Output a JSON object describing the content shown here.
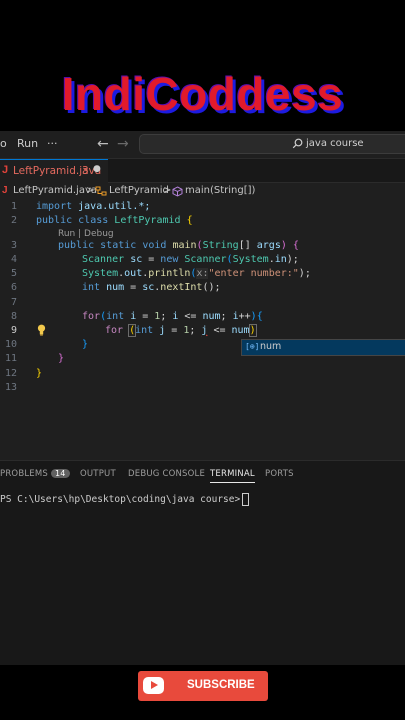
{
  "banner": {
    "text": "IndiCoddess"
  },
  "titlebar": {
    "menu_truncated": "o",
    "run_label": "Run",
    "more_label": "···",
    "back_glyph": "←",
    "forward_glyph": "→",
    "search_text": "java course",
    "search_icon": "search-icon"
  },
  "tab": {
    "icon_letter": "J",
    "filename": "LeftPyramid.java",
    "problems_count": "3",
    "modified_dot": "●"
  },
  "breadcrumbs": {
    "file_icon": "J",
    "file": "LeftPyramid.java",
    "sep1": ">",
    "class_icon": "class-icon",
    "class_name": "LeftPyramid",
    "sep2": ">",
    "method_icon": "method-icon",
    "method": "main(String[])"
  },
  "editor": {
    "line_numbers": [
      "1",
      "2",
      "3",
      "4",
      "5",
      "6",
      "7",
      "8",
      "9",
      "10",
      "11",
      "12",
      "13"
    ],
    "active_line": "9",
    "codelens": "Run | Debug",
    "lines": {
      "l1": {
        "kw": "import",
        "rest": " java.util.*;"
      },
      "l2": {
        "kw1": "public",
        "kw2": "class",
        "name": "LeftPyramid",
        "brace": "{"
      },
      "l3": {
        "kw1": "public",
        "kw2": "static",
        "kw3": "void",
        "fn": "main",
        "p1": "(",
        "type": "String",
        "arr": "[]",
        "arg": "args",
        "p2": ")",
        "brace": "{"
      },
      "l4": {
        "type": "Scanner",
        "var": "sc",
        "eq": " = ",
        "kw": "new",
        "type2": "Scanner",
        "p1": "(",
        "cls": "System",
        "dot": ".",
        "fld": "in",
        "p2": ");"
      },
      "l5": {
        "cls": "System",
        "dot1": ".",
        "fld": "out",
        "dot2": ".",
        "fn": "println",
        "p1": "(",
        "hint": "x:",
        "str": "\"enter number:\"",
        "p2": ");"
      },
      "l6": {
        "kw": "int",
        "var": "num",
        "eq": " = ",
        "obj": "sc",
        "dot": ".",
        "fn": "nextInt",
        "p": "();"
      },
      "l8": {
        "kw": "for",
        "p1": "(",
        "kw2": "int",
        "i": "i",
        "eq": " = ",
        "one": "1",
        "semi1": "; ",
        "i2": "i",
        "le": " <= ",
        "num": "num",
        "semi2": "; ",
        "i3": "i",
        "inc": "++",
        "p2": ")",
        "brace": "{"
      },
      "l9": {
        "kw": "for",
        "p1": "(",
        "kw2": "int",
        "j": "j",
        "eq": " = ",
        "one": "1",
        "semi1": "; ",
        "j2": "j",
        "le": " <= ",
        "num": "num",
        "p2": ")"
      },
      "l10": {
        "brace": "}"
      },
      "l11": {
        "brace": "}"
      },
      "l12": {
        "brace": "}"
      }
    },
    "suggestion": {
      "icon": "[⊕]",
      "label": "num"
    }
  },
  "panel": {
    "tabs": [
      "PROBLEMS",
      "OUTPUT",
      "DEBUG CONSOLE",
      "TERMINAL",
      "PORTS"
    ],
    "problems_badge": "14",
    "active_tab": "TERMINAL",
    "terminal_prompt": "PS C:\\Users\\hp\\Desktop\\coding\\java course>"
  },
  "subscribe": {
    "label": "SUBSCRIBE",
    "icon": "youtube-icon"
  },
  "colors": {
    "accent": "#0078d4",
    "subscribe": "#e84a3c",
    "banner_red": "#e11a2b",
    "banner_blue": "#1d1be0",
    "editor_bg": "#1f1f1f"
  }
}
